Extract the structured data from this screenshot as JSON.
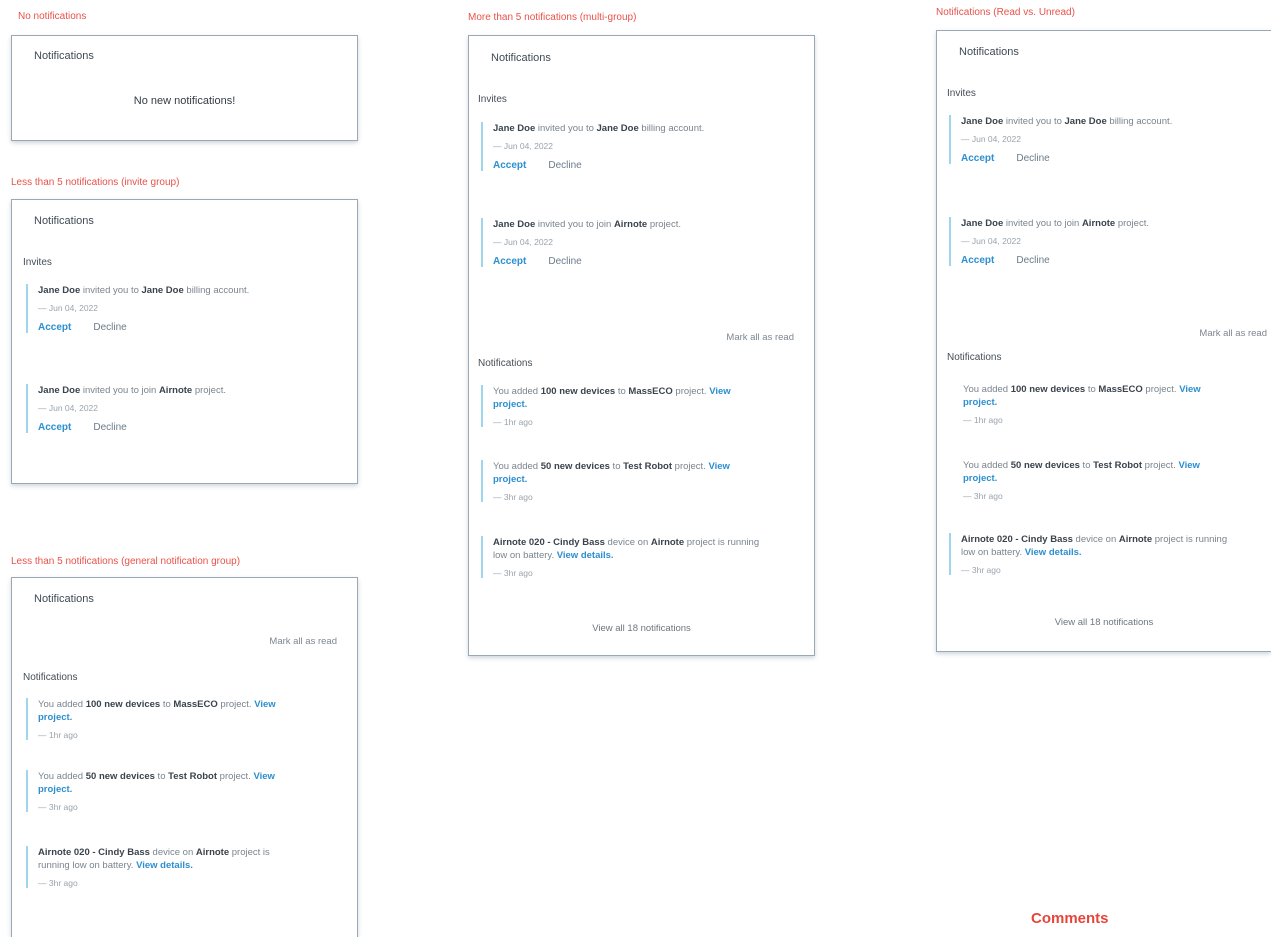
{
  "sections": {
    "no_notifications": "No notifications",
    "less_invite": "Less than 5 notifications (invite group)",
    "less_general": "Less than 5 notifications (general notification group)",
    "more_multi": "More than 5 notifications (multi-group)",
    "read_unread": "Notifications (Read vs. Unread)"
  },
  "comments_label": "Comments",
  "panel_title": "Notifications",
  "empty_message": "No new notifications!",
  "group_invites": "Invites",
  "group_notifications": "Notifications",
  "mark_all_read": "Mark all as read",
  "view_all": "View all 18 notifications",
  "actions": {
    "accept": "Accept",
    "decline": "Decline"
  },
  "invites": [
    {
      "actor": "Jane Doe",
      "text1": " invited you to ",
      "target": "Jane Doe",
      "text2": " billing account.",
      "time": "— Jun 04, 2022"
    },
    {
      "actor": "Jane Doe",
      "text1": " invited you to join ",
      "target": "Airnote",
      "text2": " project.",
      "time": "— Jun 04, 2022"
    }
  ],
  "notifications": [
    {
      "prefix": "You added ",
      "strong1": "100 new devices",
      "middle": " to ",
      "strong2": "MassECO",
      "suffix": " project. ",
      "link": "View project.",
      "time": "— 1hr ago"
    },
    {
      "prefix": "You added ",
      "strong1": "50 new devices",
      "middle": " to ",
      "strong2": "Test Robot",
      "suffix": " project. ",
      "link": "View project.",
      "time": "— 3hr ago"
    },
    {
      "prefix": "",
      "strong1": "Airnote 020 - Cindy Bass",
      "middle": " device on ",
      "strong2": "Airnote",
      "suffix": " project is running low on battery. ",
      "link": "View details.",
      "time": "— 3hr ago"
    }
  ],
  "colors": {
    "section_label": "#e8524a",
    "accent_link": "#2c8fd0",
    "item_border": "#9fd6ee",
    "panel_border": "#9aa8b4"
  }
}
